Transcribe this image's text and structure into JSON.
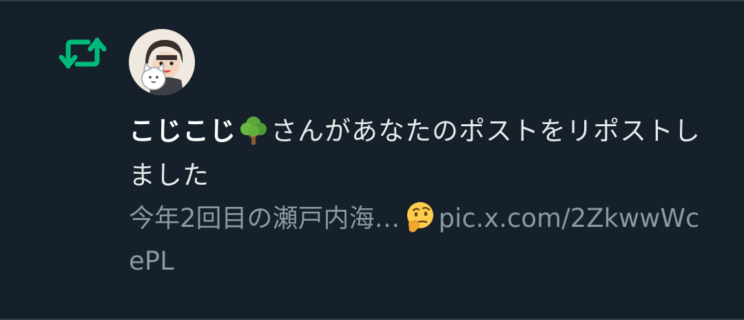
{
  "notification": {
    "type_icon": "repost-icon",
    "avatar_icon": "user-avatar",
    "username": "こじこじ",
    "username_emoji": "tree-emoji",
    "action_text": "さんがあなたのポストをリポストしました",
    "post_preview": {
      "text": "今年2回目の瀬戸内海…",
      "emoji": "thinking-face-emoji",
      "link": "pic.x.com/2ZkwwWcePL"
    }
  },
  "colors": {
    "background": "#15202b",
    "repost_green": "#00ba7c",
    "text_primary": "#e7e9ea",
    "text_secondary": "#8b98a5",
    "divider": "#2f3b47"
  }
}
